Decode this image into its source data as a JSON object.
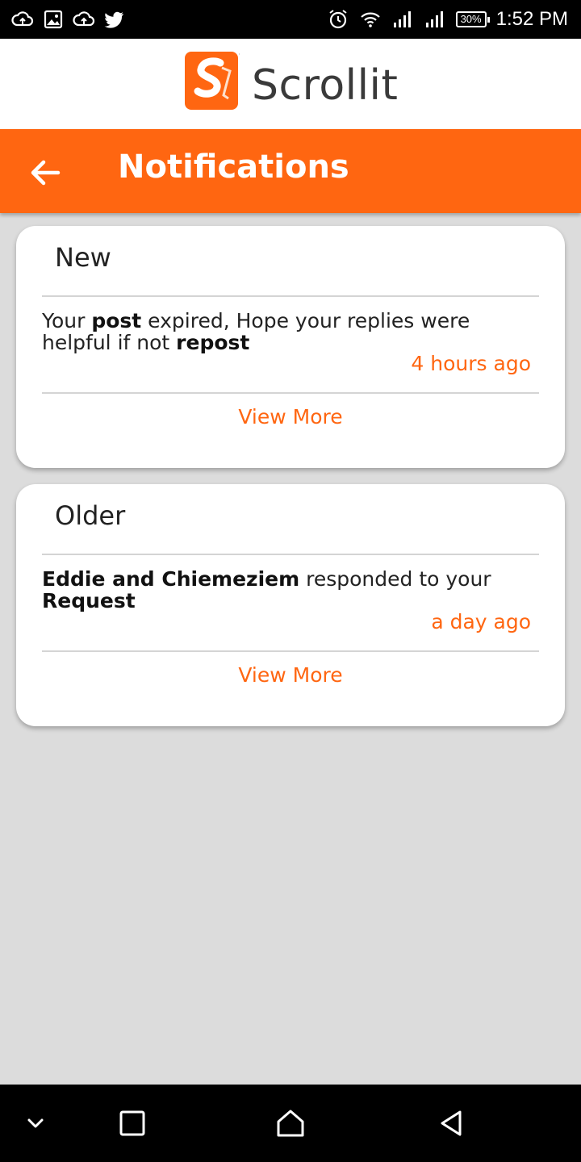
{
  "status_bar": {
    "left_icons": [
      "cloud-upload-icon",
      "image-icon",
      "cloud-upload-icon",
      "twitter-icon"
    ],
    "right_icons": [
      "alarm-icon",
      "wifi-icon",
      "signal-icon",
      "signal-icon"
    ],
    "battery": "30%",
    "time": "1:52 PM"
  },
  "brand": {
    "name": "Scrollit",
    "logo_letter": "S",
    "color": "#ff6611"
  },
  "app_bar": {
    "title": "Notifications",
    "back_icon": "arrow-left-icon"
  },
  "sections": [
    {
      "heading": "New",
      "message_parts": [
        {
          "text": "Your ",
          "bold": false
        },
        {
          "text": "post",
          "bold": true
        },
        {
          "text": " expired, Hope your replies were helpful if not ",
          "bold": false
        },
        {
          "text": "repost",
          "bold": true
        }
      ],
      "time": "4 hours ago",
      "action": "View More"
    },
    {
      "heading": "Older",
      "message_parts": [
        {
          "text": "Eddie and Chiemeziem",
          "bold": true
        },
        {
          "text": " responded to your ",
          "bold": false
        },
        {
          "text": "Request",
          "bold": true
        }
      ],
      "time": "a day ago",
      "action": "View More"
    }
  ],
  "nav_bar": {
    "buttons": [
      "chevron-down-icon",
      "square-icon",
      "home-icon",
      "back-triangle-icon"
    ]
  }
}
